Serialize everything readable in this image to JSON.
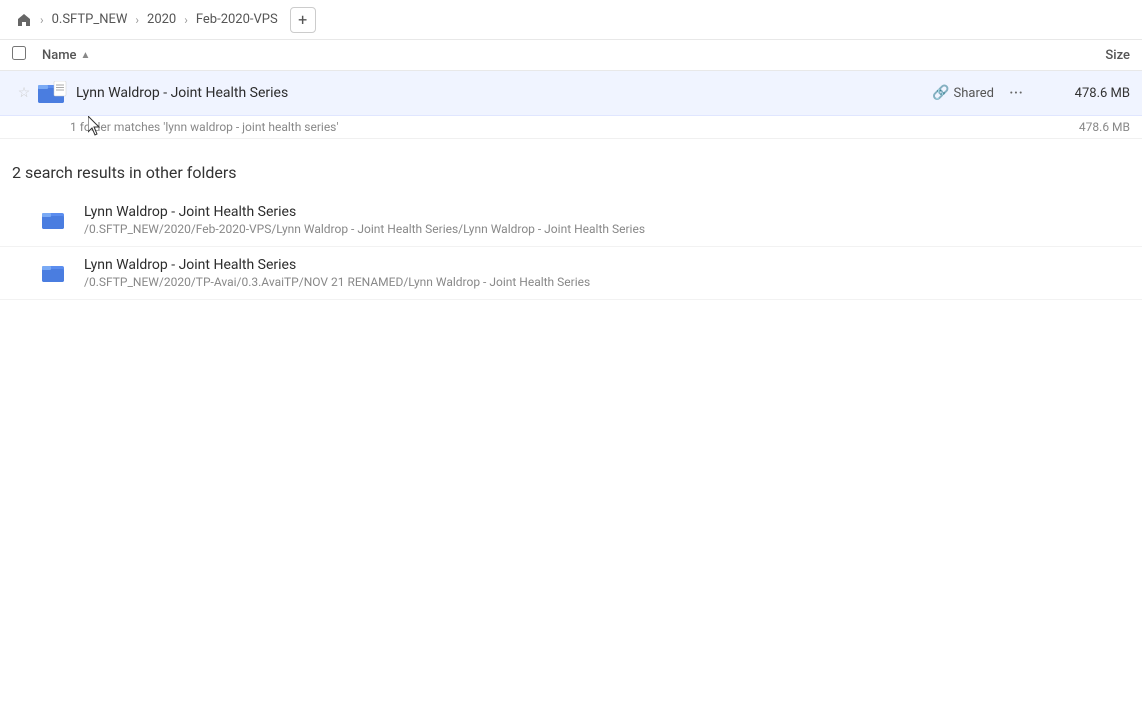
{
  "breadcrumb": {
    "home_icon": "🏠",
    "items": [
      {
        "label": "0.SFTP_NEW"
      },
      {
        "label": "2020"
      },
      {
        "label": "Feb-2020-VPS"
      }
    ],
    "add_label": "+"
  },
  "columns": {
    "name_label": "Name",
    "size_label": "Size",
    "sort_arrow": "▲"
  },
  "primary_result": {
    "folder_name": "Lynn Waldrop - Joint Health Series",
    "shared_label": "Shared",
    "size": "478.6 MB",
    "match_count": "1 folder matches 'lynn waldrop - joint health series'",
    "match_size": "478.6 MB"
  },
  "other_section": {
    "header": "2 search results in other folders",
    "results": [
      {
        "name": "Lynn Waldrop - Joint Health Series",
        "path": "/0.SFTP_NEW/2020/Feb-2020-VPS/Lynn Waldrop - Joint Health Series/Lynn Waldrop - Joint Health Series"
      },
      {
        "name": "Lynn Waldrop - Joint Health Series",
        "path": "/0.SFTP_NEW/2020/TP-Avai/0.3.AvaiTP/NOV 21 RENAMED/Lynn Waldrop - Joint Health Series"
      }
    ]
  }
}
